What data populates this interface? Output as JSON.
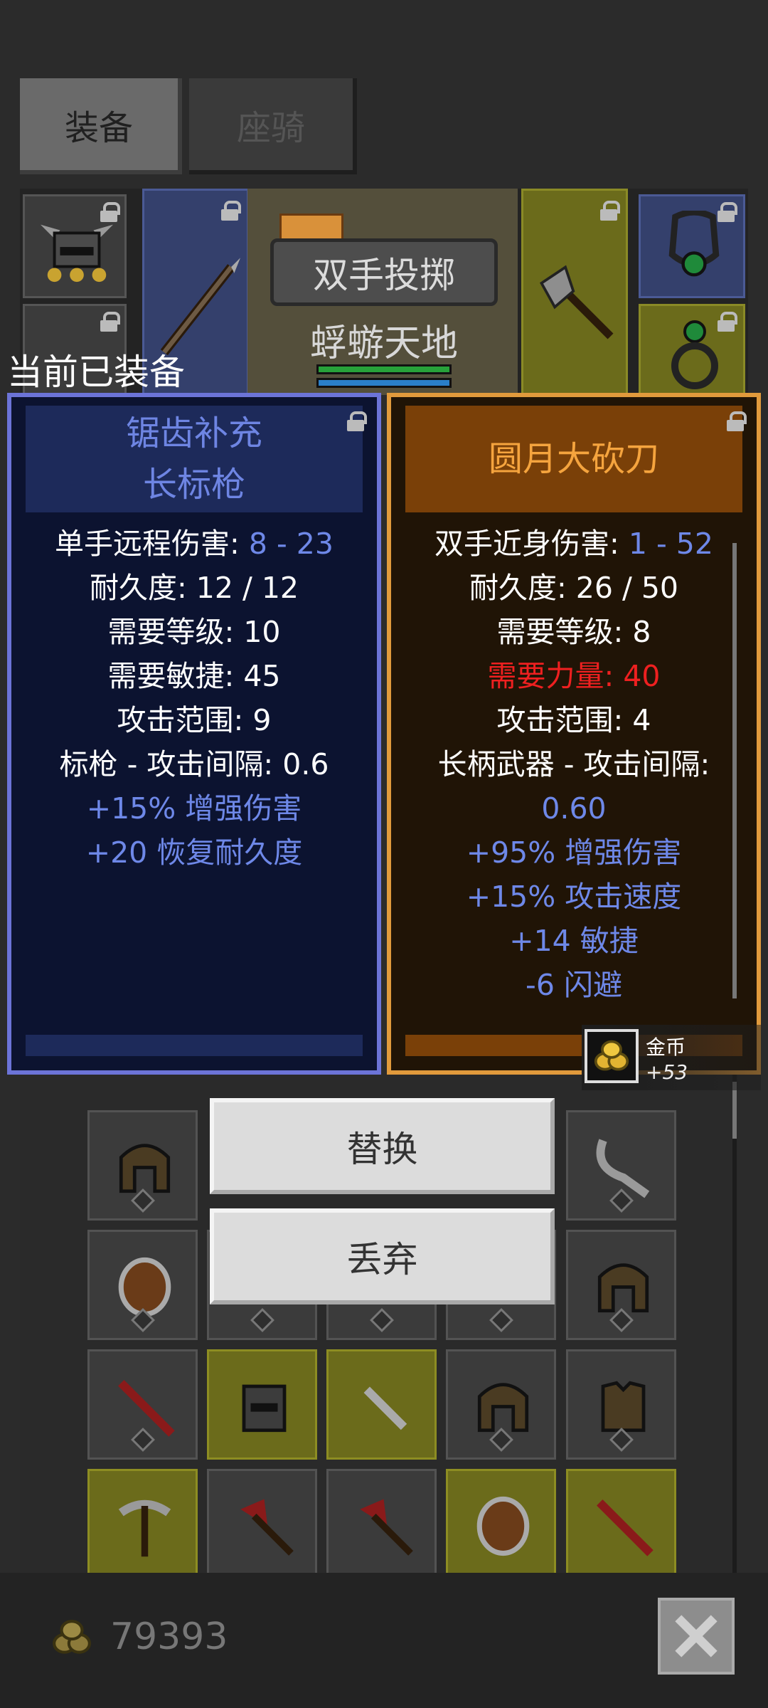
{
  "tabs": {
    "equipment": "装备",
    "mount": "座骑"
  },
  "scene": {
    "skill_name": "双手投掷",
    "location": "蜉蝣天地"
  },
  "equipped_label": "当前已装备",
  "current_item": {
    "name_line1": "锯齿补充",
    "name_line2": "长标枪",
    "damage_label": "单手远程伤害: ",
    "damage_value": "8 - 23",
    "durability": "耐久度: 12 / 12",
    "level_req": "需要等级: 10",
    "attr_req": "需要敏捷: 45",
    "range": "攻击范围: 9",
    "interval": "标枪 - 攻击间隔: 0.6",
    "bonuses": [
      "+15% 增强伤害",
      "+20 恢复耐久度"
    ]
  },
  "new_item": {
    "name": "圆月大砍刀",
    "damage_label": "双手近身伤害: ",
    "damage_value": "1 - 52",
    "durability": "耐久度: 26 / 50",
    "level_req": "需要等级: 8",
    "attr_req": "需要力量: 40",
    "range": "攻击范围: 4",
    "interval_label": "长柄武器 - 攻击间隔:",
    "interval_value": "0.60",
    "bonuses": [
      "+95% 增强伤害",
      "+15% 攻击速度",
      "+14 敏捷",
      "-6 闪避"
    ]
  },
  "gold_popup": {
    "label": "金币",
    "delta": "+53"
  },
  "actions": {
    "replace": "替换",
    "discard": "丢弃"
  },
  "gold_total": "79393",
  "colors": {
    "blue_text": "#6e88e8",
    "orange_title": "#f5a43e",
    "red_text": "#ee2020"
  }
}
